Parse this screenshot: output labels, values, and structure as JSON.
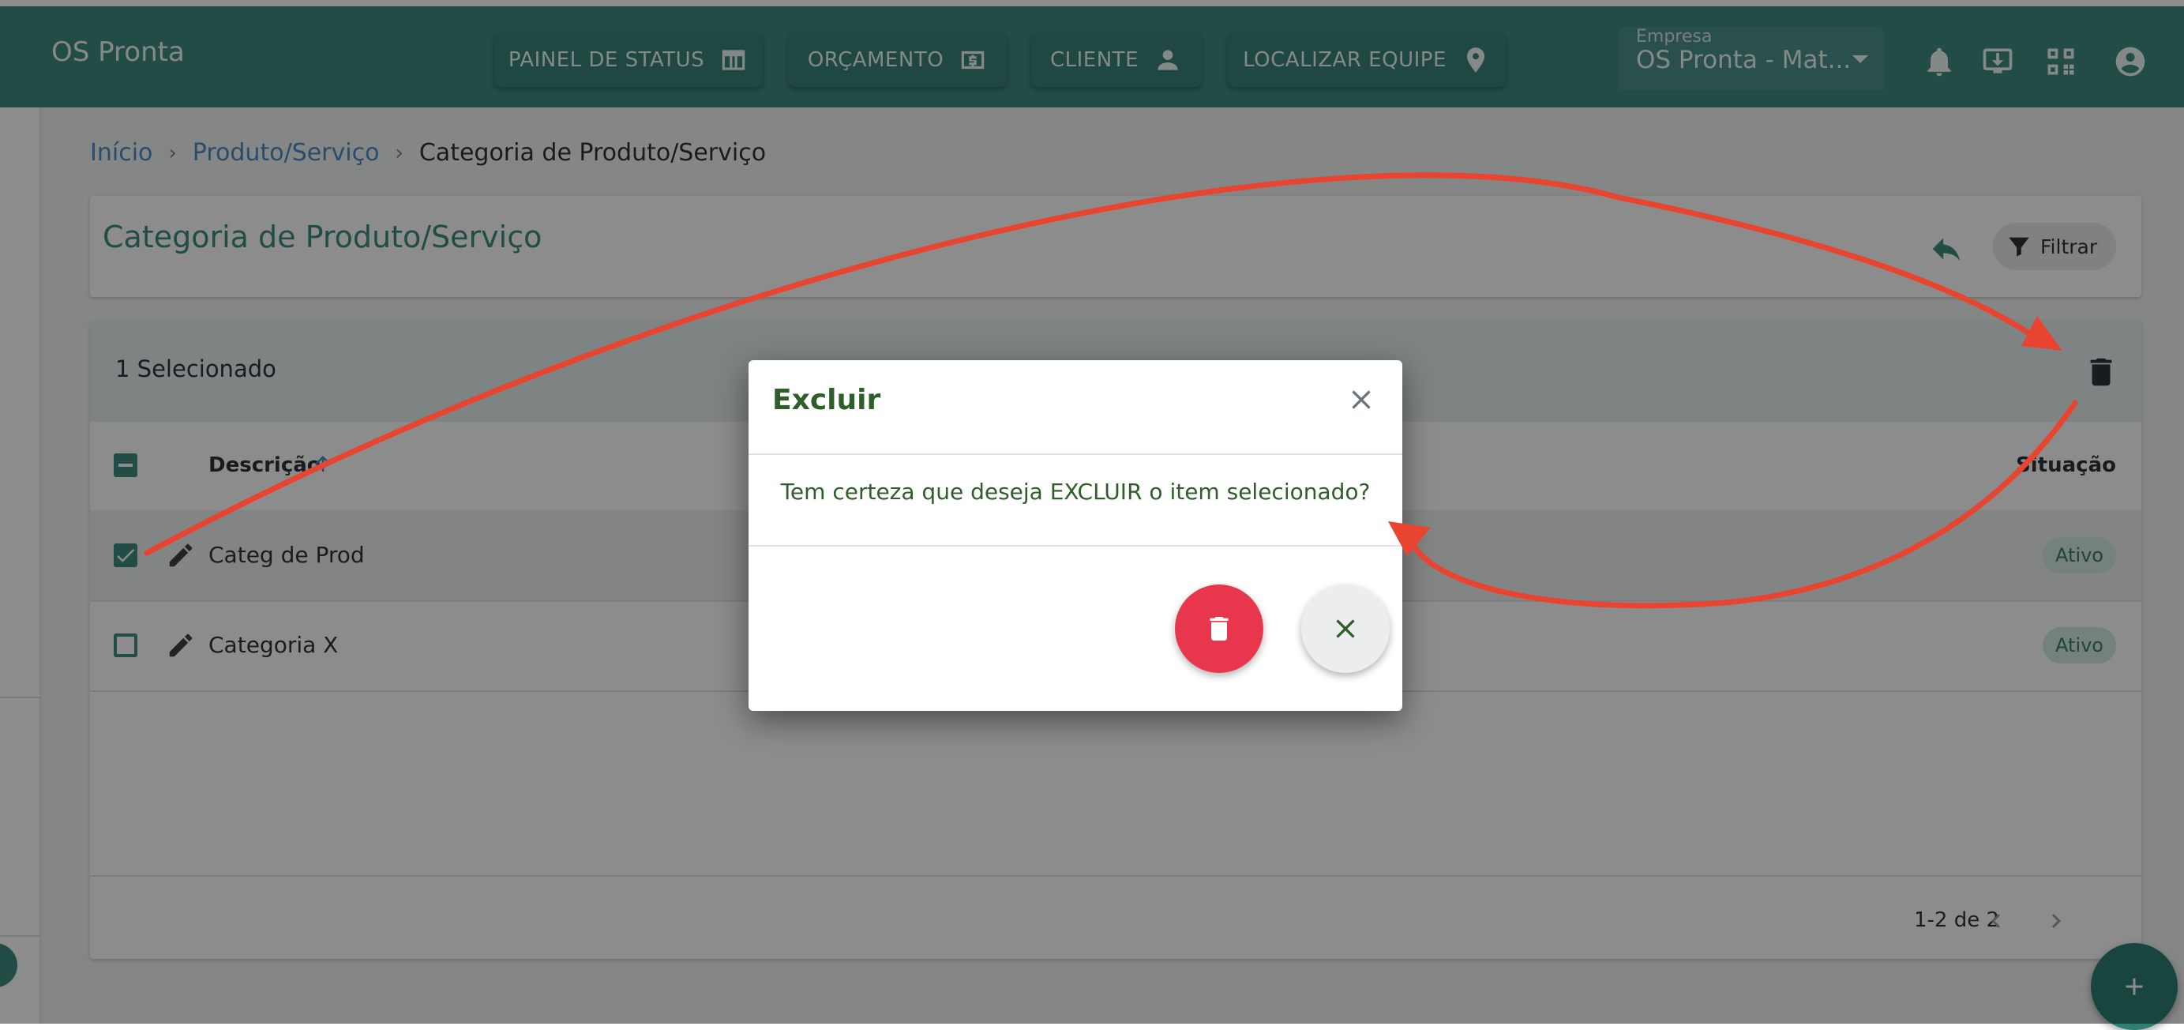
{
  "app": {
    "title": "OS Pronta"
  },
  "nav": [
    {
      "label": "PAINEL DE STATUS",
      "icon": "table-icon"
    },
    {
      "label": "ORÇAMENTO",
      "icon": "money-icon"
    },
    {
      "label": "CLIENTE",
      "icon": "person-icon"
    },
    {
      "label": "LOCALIZAR EQUIPE",
      "icon": "location-pin-icon"
    }
  ],
  "empresa": {
    "label": "Empresa",
    "value": "OS Pronta - Mat..."
  },
  "breadcrumb": {
    "home": "Início",
    "parent": "Produto/Serviço",
    "current": "Categoria de Produto/Serviço",
    "separator": "›"
  },
  "page": {
    "title": "Categoria de Produto/Serviço",
    "filter_label": "Filtrar"
  },
  "table": {
    "selected_text": "1 Selecionado",
    "columns": {
      "description": "Descrição",
      "status": "Situação"
    },
    "rows": [
      {
        "name": "Categ de Prod",
        "status": "Ativo",
        "checked": true
      },
      {
        "name": "Categoria X",
        "status": "Ativo",
        "checked": false
      }
    ],
    "pagination": "1-2 de 2"
  },
  "dialog": {
    "title": "Excluir",
    "message": "Tem certeza que deseja EXCLUIR o item selecionado?"
  },
  "colors": {
    "primary": "#3e8a80",
    "link": "#4c8bc4",
    "danger": "#e8374c",
    "annotation": "#e8442f"
  }
}
